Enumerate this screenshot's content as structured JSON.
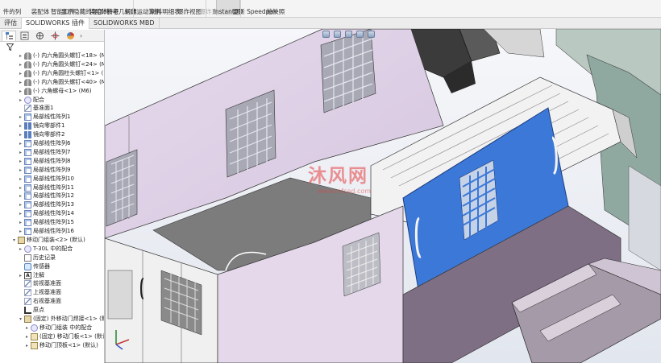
{
  "ribbon": {
    "buttons": [
      {
        "label": "件的列",
        "state": "normal"
      },
      {
        "label": "装配体",
        "state": "normal"
      },
      {
        "label": "智能扣件",
        "state": "normal"
      },
      {
        "label": "显示隐藏的零部件",
        "state": "normal"
      },
      {
        "label": "装配体特征",
        "state": "normal"
      },
      {
        "label": "参考几何体",
        "state": "normal"
      },
      {
        "label": "新建运动算例",
        "state": "normal"
      },
      {
        "label": "材料明细表",
        "state": "normal"
      },
      {
        "label": "爆炸视图",
        "state": "normal"
      },
      {
        "label": "爆炸直线草图",
        "state": "disabled"
      },
      {
        "label": "Instant3D",
        "state": "active"
      },
      {
        "label": "更新 Speedpak",
        "state": "normal"
      },
      {
        "label": "拍快照",
        "state": "normal"
      }
    ]
  },
  "command_tabs": [
    "评估",
    "SOLIDWORKS 插件",
    "SOLIDWORKS MBD"
  ],
  "tree": {
    "items": [
      {
        "label": "(-) 内六角圆头螺钉<18> (M6)",
        "icon": "screw-icon",
        "level": 1,
        "expander": "▸"
      },
      {
        "label": "(-) 内六角圆头螺钉<24> (M6)",
        "icon": "screw-icon",
        "level": 1,
        "expander": "▸"
      },
      {
        "label": "(-) 内六角圆柱头螺钉<1> (M",
        "icon": "screw-icon",
        "level": 1,
        "expander": "▸"
      },
      {
        "label": "(-) 内六角圆头螺钉<40> (M6)",
        "icon": "screw-icon",
        "level": 1,
        "expander": "▸"
      },
      {
        "label": "(-) 六角螺母<1> (M6)",
        "icon": "screw-icon",
        "level": 1,
        "expander": "▸"
      },
      {
        "label": "配合",
        "icon": "mate-icon",
        "level": 1,
        "expander": "▸"
      },
      {
        "label": "基准面1",
        "icon": "plane-icon",
        "level": 1,
        "expander": ""
      },
      {
        "label": "局部线性阵列1",
        "icon": "pattern-icon",
        "level": 1,
        "expander": "▸"
      },
      {
        "label": "镜向零部件1",
        "icon": "mirror-icon",
        "level": 1,
        "expander": "▸"
      },
      {
        "label": "镜向零部件2",
        "icon": "mirror-icon",
        "level": 1,
        "expander": "▸"
      },
      {
        "label": "局部线性阵列6",
        "icon": "pattern-icon",
        "level": 1,
        "expander": "▸"
      },
      {
        "label": "局部线性阵列7",
        "icon": "pattern-icon",
        "level": 1,
        "expander": "▸"
      },
      {
        "label": "局部线性阵列8",
        "icon": "pattern-icon",
        "level": 1,
        "expander": "▸"
      },
      {
        "label": "局部线性阵列9",
        "icon": "pattern-icon",
        "level": 1,
        "expander": "▸"
      },
      {
        "label": "局部线性阵列10",
        "icon": "pattern-icon",
        "level": 1,
        "expander": "▸"
      },
      {
        "label": "局部线性阵列11",
        "icon": "pattern-icon",
        "level": 1,
        "expander": "▸"
      },
      {
        "label": "局部线性阵列12",
        "icon": "pattern-icon",
        "level": 1,
        "expander": "▸"
      },
      {
        "label": "局部线性阵列13",
        "icon": "pattern-icon",
        "level": 1,
        "expander": "▸"
      },
      {
        "label": "局部线性阵列14",
        "icon": "pattern-icon",
        "level": 1,
        "expander": "▸"
      },
      {
        "label": "局部线性阵列15",
        "icon": "pattern-icon",
        "level": 1,
        "expander": "▸"
      },
      {
        "label": "局部线性阵列16",
        "icon": "pattern-icon",
        "level": 1,
        "expander": "▸"
      },
      {
        "label": "移动门组装<2> (默认)",
        "icon": "assembly-icon",
        "level": 0,
        "expander": "▾"
      },
      {
        "label": "T-30L 中的配合",
        "icon": "mate-icon",
        "level": 1,
        "expander": "▸"
      },
      {
        "label": "历史记录",
        "icon": "history-icon",
        "level": 1,
        "expander": ""
      },
      {
        "label": "传感器",
        "icon": "sensor-icon",
        "level": 1,
        "expander": ""
      },
      {
        "label": "注解",
        "icon": "annotation-icon",
        "level": 1,
        "expander": "▸"
      },
      {
        "label": "前视基准面",
        "icon": "plane-icon",
        "level": 1,
        "expander": ""
      },
      {
        "label": "上视基准面",
        "icon": "plane-icon",
        "level": 1,
        "expander": ""
      },
      {
        "label": "右视基准面",
        "icon": "plane-icon",
        "level": 1,
        "expander": ""
      },
      {
        "label": "原点",
        "icon": "origin-icon",
        "level": 1,
        "expander": ""
      },
      {
        "label": "(固定) 外移动门焊接<1> (默认",
        "icon": "assembly-icon",
        "level": 1,
        "expander": "▾"
      },
      {
        "label": "移动门组装 中的配合",
        "icon": "mate-icon",
        "level": 2,
        "expander": "▸"
      },
      {
        "label": "(固定) 移动门板<1> (默认",
        "icon": "part-icon",
        "level": 2,
        "expander": "▸"
      },
      {
        "label": "移动门顶板<1> (默认)",
        "icon": "part-icon",
        "level": 2,
        "expander": "▸"
      }
    ]
  },
  "annotation_glyph": "A",
  "watermark": {
    "main": "沐风网",
    "sub": "www.mfcad.com"
  },
  "colors": {
    "panel_pink": "#ddd0e4",
    "door_blue": "#3c78d8",
    "rail_white": "#f2f2f2",
    "step_gray": "#a59aa8"
  }
}
